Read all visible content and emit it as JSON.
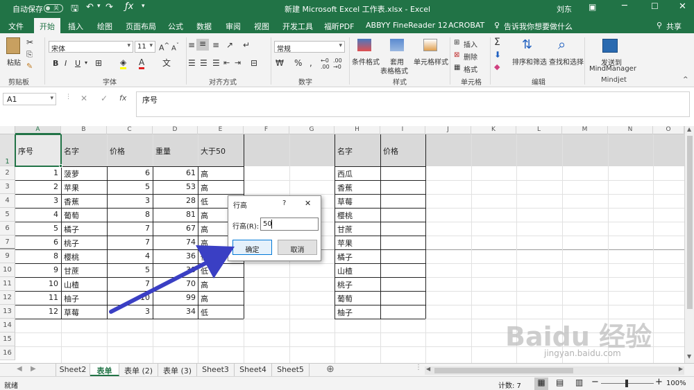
{
  "titlebar": {
    "autosave": "自动保存",
    "autosave_state": "关",
    "title": "新建 Microsoft Excel 工作表.xlsx - Excel",
    "user": "刘东"
  },
  "tabs": [
    "文件",
    "开始",
    "插入",
    "绘图",
    "页面布局",
    "公式",
    "数据",
    "审阅",
    "视图",
    "开发工具",
    "福昕PDF",
    "ABBYY FineReader 12",
    "ACROBAT"
  ],
  "tellme": "告诉我你想要做什么",
  "share": "共享",
  "ribbon": {
    "paste": "粘贴",
    "clipboard": "剪贴板",
    "font_name": "宋体",
    "font_size": "11",
    "font_group": "字体",
    "align_group": "对齐方式",
    "number_format": "常规",
    "number_group": "数字",
    "cond_format": "条件格式",
    "table_format_1": "套用",
    "table_format_2": "表格格式",
    "cell_style": "单元格样式",
    "style_group": "样式",
    "insert": "插入",
    "delete": "删除",
    "format": "格式",
    "cells_group": "单元格",
    "sort_filter": "排序和筛选",
    "find_select": "查找和选择",
    "edit_group": "编辑",
    "send_to_1": "发送到",
    "send_to_2": "MindManager",
    "mindjet_group": "Mindjet"
  },
  "formula": {
    "namebox": "A1",
    "fx": "fx",
    "content": "序号"
  },
  "columns": [
    "A",
    "B",
    "C",
    "D",
    "E",
    "F",
    "G",
    "H",
    "I",
    "J",
    "K",
    "L",
    "M",
    "N",
    "O"
  ],
  "rows": [
    "1",
    "2",
    "3",
    "4",
    "5",
    "6",
    "7",
    "9",
    "10",
    "11",
    "12",
    "13",
    "14",
    "15",
    "16"
  ],
  "headers_left": [
    "序号",
    "名字",
    "价格",
    "重量",
    "大于50"
  ],
  "table_left": [
    [
      "1",
      "菠萝",
      "6",
      "61",
      "高"
    ],
    [
      "2",
      "苹果",
      "5",
      "53",
      "高"
    ],
    [
      "3",
      "香蕉",
      "3",
      "28",
      "低"
    ],
    [
      "4",
      "葡萄",
      "8",
      "81",
      "高"
    ],
    [
      "5",
      "橘子",
      "7",
      "67",
      "高"
    ],
    [
      "6",
      "桃子",
      "7",
      "74",
      "高"
    ],
    [
      "8",
      "樱桃",
      "4",
      "36",
      "低"
    ],
    [
      "9",
      "甘蔗",
      "5",
      "30",
      "低"
    ],
    [
      "10",
      "山楂",
      "7",
      "70",
      "高"
    ],
    [
      "11",
      "柚子",
      "10",
      "99",
      "高"
    ],
    [
      "12",
      "草莓",
      "3",
      "34",
      "低"
    ]
  ],
  "headers_right": [
    "名字",
    "价格"
  ],
  "table_right": [
    "西瓜",
    "香蕉",
    "草莓",
    "樱桃",
    "甘蔗",
    "苹果",
    "橘子",
    "山楂",
    "桃子",
    "葡萄",
    "柚子"
  ],
  "sheets": [
    "Sheet2",
    "表单",
    "表单 (2)",
    "表单 (3)",
    "Sheet3",
    "Sheet4",
    "Sheet5"
  ],
  "status": {
    "ready": "就绪",
    "count": "计数: 7",
    "zoom": "100%"
  },
  "dialog": {
    "title": "行高",
    "help": "?",
    "close": "✕",
    "label": "行高(R):",
    "value": "50",
    "ok": "确定",
    "cancel": "取消"
  },
  "watermark": {
    "brand": "Baidu 经验",
    "url": "jingyan.baidu.com"
  },
  "colors": {
    "excel_green": "#217346",
    "arrow": "#3a3fc4",
    "header_fill": "#d9d9d9"
  }
}
